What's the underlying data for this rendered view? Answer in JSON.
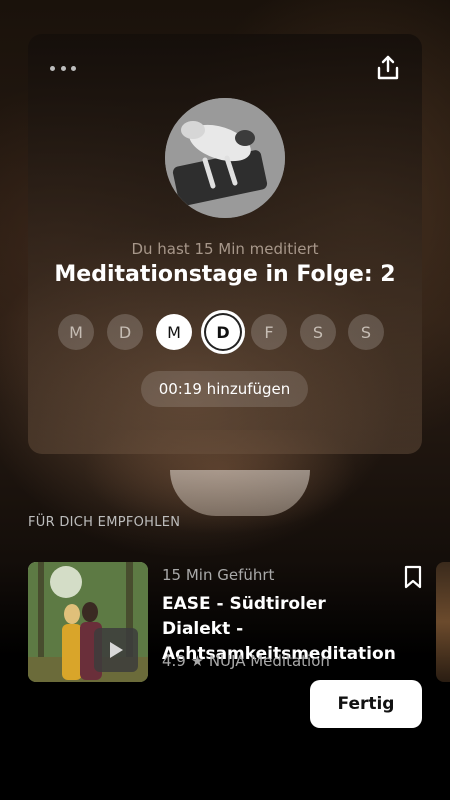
{
  "header": {
    "more_icon": "more-horizontal-icon",
    "share_icon": "share-upload-icon"
  },
  "summary": {
    "avatar_icon": "meditation-photo-dog-avatar",
    "subtitle": "Du hast 15 Min meditiert",
    "title": "Meditationstage in Folge: 2",
    "days": [
      {
        "letter": "M",
        "state": "empty"
      },
      {
        "letter": "D",
        "state": "empty"
      },
      {
        "letter": "M",
        "state": "done"
      },
      {
        "letter": "D",
        "state": "today"
      },
      {
        "letter": "F",
        "state": "empty"
      },
      {
        "letter": "S",
        "state": "empty"
      },
      {
        "letter": "S",
        "state": "empty"
      }
    ],
    "add_time_label": "00:19 hinzufügen"
  },
  "recommendations": {
    "section_label": "FÜR DICH EMPFOHLEN",
    "items": [
      {
        "meta": "15 Min Geführt",
        "title": "EASE - Südtiroler Dialekt -Achtsamkeitsmeditation",
        "rating": "4.9 ★ NUJA Meditation",
        "play_icon": "play-icon",
        "bookmark_icon": "bookmark-icon"
      }
    ]
  },
  "footer": {
    "done_label": "Fertig"
  },
  "colors": {
    "background": "#1a120b",
    "button_bg": "#ffffff",
    "muted_text": "#a9a9a9"
  }
}
